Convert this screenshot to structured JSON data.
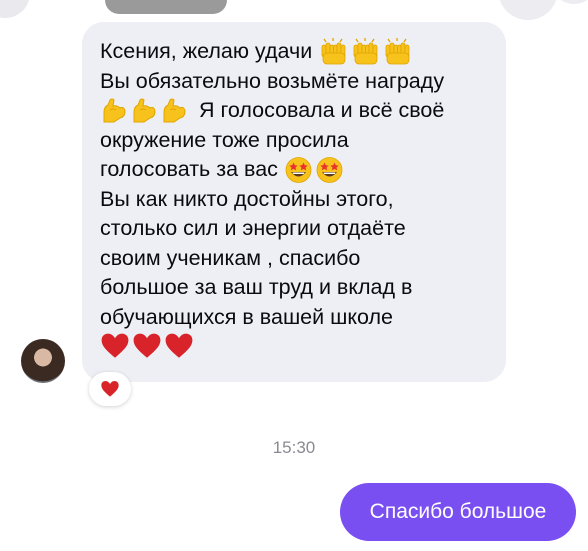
{
  "conversation": {
    "incoming_message": {
      "line1": "Ксения, желаю удачи",
      "line2": "Вы обязательно возьмёте награду",
      "line3": "Я голосовала и всё своё",
      "line4": "окружение тоже просила",
      "line5": "голосовать за вас",
      "line6": "Вы как никто достойны этого,",
      "line7": "столько сил и энергии отдаёте",
      "line8": "своим ученикам , спасибо",
      "line9": "большое за ваш труд и вклад в",
      "line10": "обучающихся в вашей школе",
      "emojis": {
        "line1": [
          "raising-hands-icon",
          "raising-hands-icon",
          "raising-hands-icon"
        ],
        "line3": [
          "flexed-biceps-icon",
          "flexed-biceps-icon",
          "flexed-biceps-icon"
        ],
        "line5": [
          "star-struck-face-icon",
          "star-struck-face-icon"
        ],
        "line11": [
          "red-heart-icon",
          "red-heart-icon",
          "red-heart-icon"
        ]
      }
    },
    "reaction": "red-heart-icon",
    "timestamp": "15:30",
    "outgoing_message": "Спасибо большое"
  },
  "colors": {
    "incoming_bubble": "#eeeff4",
    "outgoing_bubble": "#7a4ff2",
    "timestamp_text": "#8a8a92",
    "heart": "#d8232a",
    "emoji_yellow": "#f7c21b"
  }
}
